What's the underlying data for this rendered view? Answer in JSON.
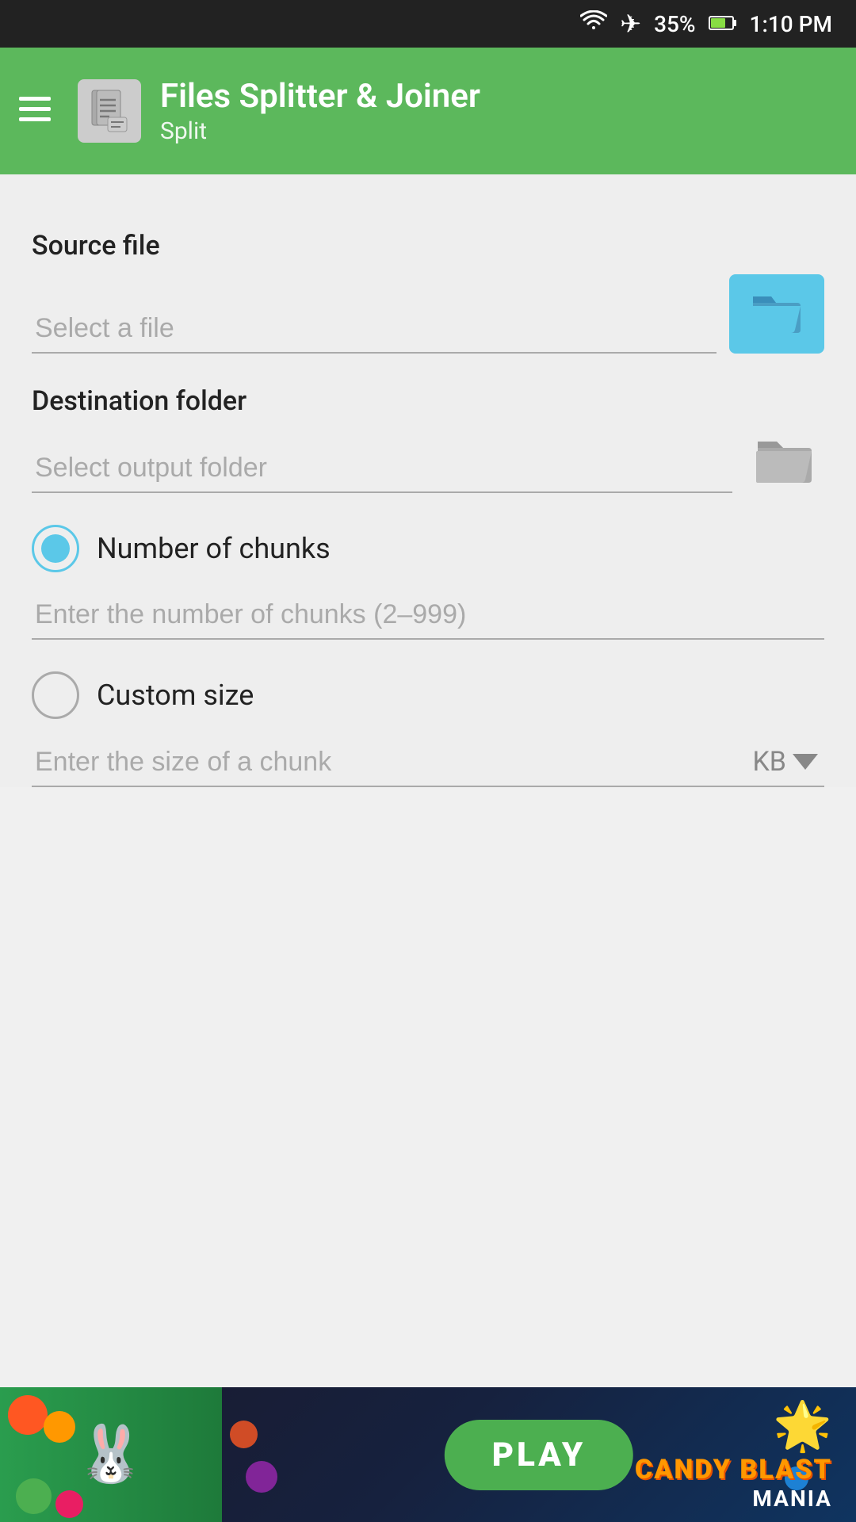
{
  "statusBar": {
    "battery": "35%",
    "time": "1:10 PM"
  },
  "header": {
    "appName": "Files Splitter & Joiner",
    "screenName": "Split"
  },
  "sourceFile": {
    "label": "Source file",
    "placeholder": "Select a file"
  },
  "destinationFolder": {
    "label": "Destination folder",
    "placeholder": "Select output folder"
  },
  "numberOfChunks": {
    "label": "Number of chunks",
    "placeholder": "Enter the number of chunks (2–999)",
    "selected": true
  },
  "customSize": {
    "label": "Custom size",
    "placeholder": "Enter the size of a chunk",
    "unit": "KB",
    "selected": false
  },
  "adBanner": {
    "playLabel": "PLAY",
    "gameName1": "CANDY BLAST",
    "gameName2": "MANIA"
  }
}
